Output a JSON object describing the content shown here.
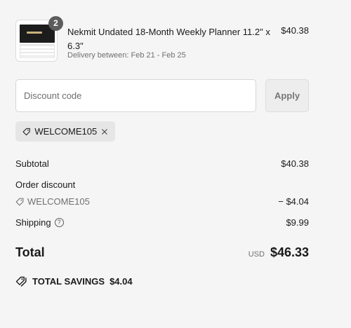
{
  "line_item": {
    "quantity": "2",
    "title": "Nekmit Undated 18-Month Weekly Planner 11.2\" x 6.3\"",
    "delivery": "Delivery between: Feb 21 - Feb 25",
    "price": "$40.38"
  },
  "discount": {
    "placeholder": "Discount code",
    "value": "",
    "apply_label": "Apply",
    "applied_code": "WELCOME105"
  },
  "summary": {
    "subtotal_label": "Subtotal",
    "subtotal_value": "$40.38",
    "order_discount_label": "Order discount",
    "discount_code": "WELCOME105",
    "discount_value": "− $4.04",
    "shipping_label": "Shipping",
    "shipping_value": "$9.99",
    "total_label": "Total",
    "currency": "USD",
    "total_value": "$46.33",
    "savings_label": "TOTAL SAVINGS",
    "savings_value": "$4.04"
  },
  "icons": {
    "tag": "tag-icon",
    "close": "close-icon",
    "help": "help-circle-icon",
    "savings": "double-tag-icon"
  },
  "colors": {
    "background": "#f5f5f5",
    "muted_text": "#707070",
    "badge": "#5c5c5c"
  }
}
